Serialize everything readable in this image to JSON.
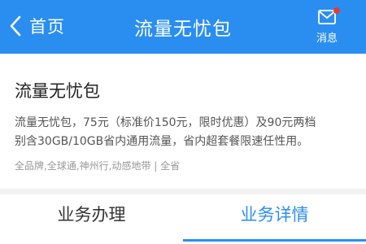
{
  "header": {
    "back_label": "首页",
    "title": "流量无忧包",
    "message_label": "消息"
  },
  "package": {
    "title": "流量无忧包",
    "description_line1": "流量无忧包，75元（标准价150元，限时优惠）及90元两档",
    "description_line2": "别含30GB/10GB省内通用流量，省内超套餐限速任性用。",
    "tags": "全品牌,全球通,神州行,动感地带 | 全省"
  },
  "tabs": [
    {
      "label": "业务办理",
      "active": false
    },
    {
      "label": "业务详情",
      "active": true
    }
  ],
  "colors": {
    "accent": "#2a8ef0",
    "badge": "#e33b3b"
  },
  "icons": {
    "back": "chevron-left-icon",
    "message": "envelope-icon"
  }
}
